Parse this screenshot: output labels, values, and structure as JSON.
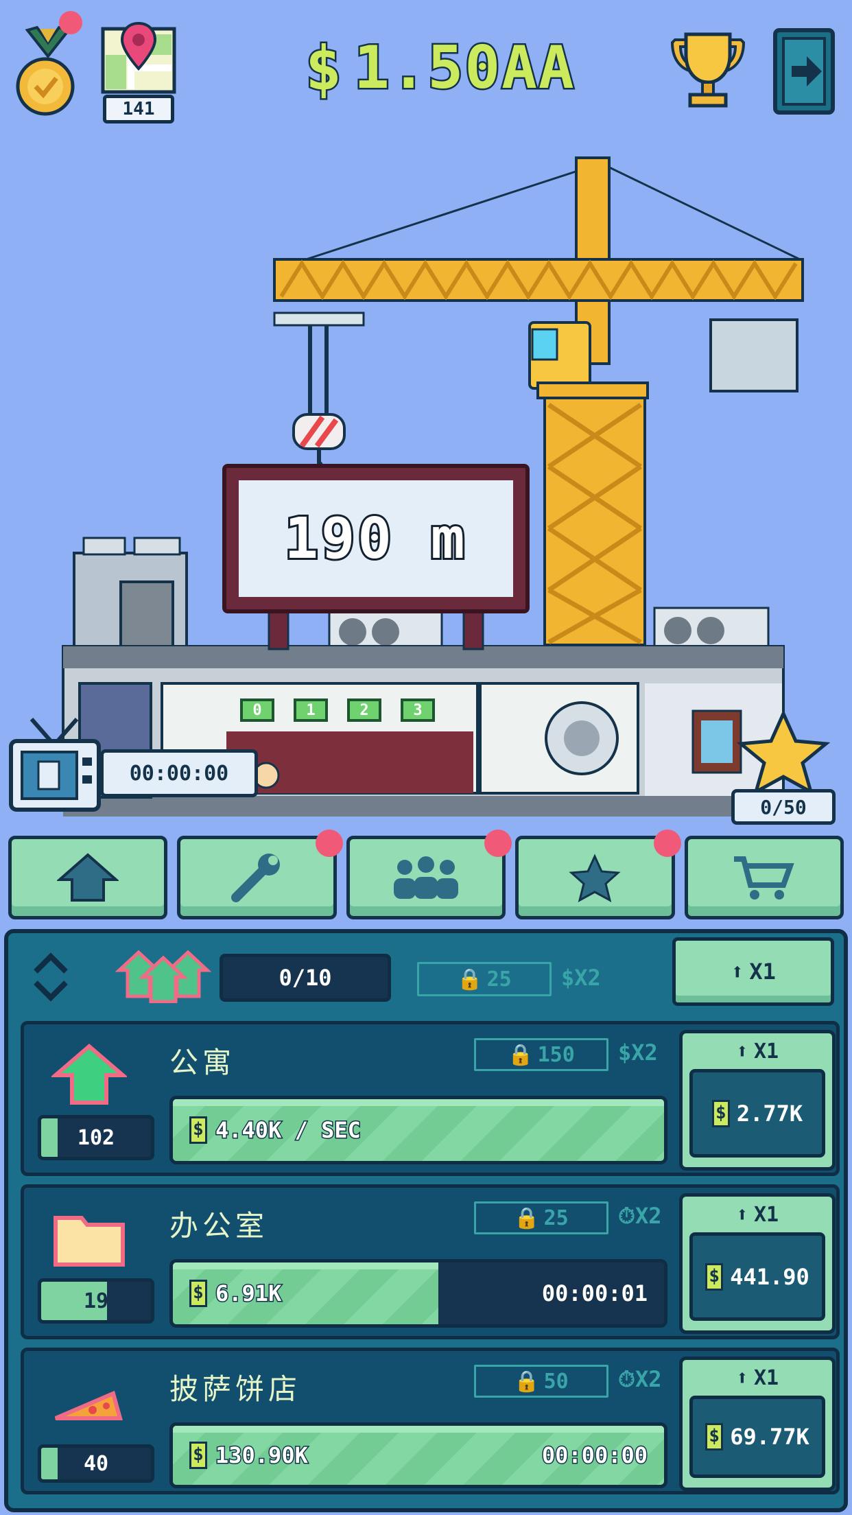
{
  "topbar": {
    "map_count": "141",
    "currency_symbol": "$",
    "currency_amount": "1.50AA"
  },
  "scene": {
    "height_label": "190 m",
    "timer": "00:00:00",
    "star_progress": "0/50",
    "floor_tags": [
      "0",
      "1",
      "2",
      "3"
    ]
  },
  "tabs": [
    {
      "icon": "house-icon",
      "has_badge": false
    },
    {
      "icon": "wrench-icon",
      "has_badge": true
    },
    {
      "icon": "people-icon",
      "has_badge": true
    },
    {
      "icon": "star-icon",
      "has_badge": true
    },
    {
      "icon": "cart-icon",
      "has_badge": false
    }
  ],
  "panel": {
    "count": "0/10",
    "lock_value": "25",
    "boost": "$X2",
    "multiplier": "X1"
  },
  "businesses": [
    {
      "name": "公寓",
      "level": "102",
      "level_fill": 0.15,
      "lock_value": "150",
      "boost": "$X2",
      "income": "4.40K / SEC",
      "progress": 1.0,
      "time": "",
      "multiplier": "X1",
      "price": "2.77K"
    },
    {
      "name": "办公室",
      "level": "19",
      "level_fill": 0.6,
      "lock_value": "25",
      "boost": "⏱X2",
      "income": "6.91K",
      "progress": 0.54,
      "time": "00:00:01",
      "multiplier": "X1",
      "price": "441.90"
    },
    {
      "name": "披萨饼店",
      "level": "40",
      "level_fill": 0.15,
      "lock_value": "50",
      "boost": "⏱X2",
      "income": "130.90K",
      "progress": 1.0,
      "time": "00:00:00",
      "multiplier": "X1",
      "price": "69.77K"
    }
  ],
  "colors": {
    "sky": "#8fb0f5",
    "accent_green": "#cbea5e",
    "panel": "#1b6f8a",
    "badge": "#f05a78",
    "crane": "#f2b531"
  }
}
